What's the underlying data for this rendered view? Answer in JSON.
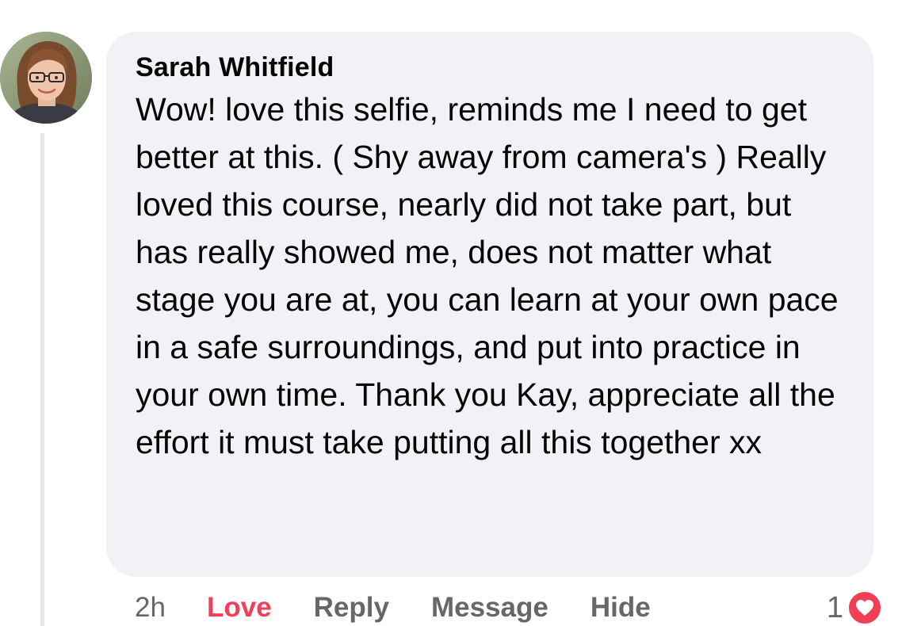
{
  "comment": {
    "author": "Sarah Whitfield",
    "text": "Wow! love this selfie, reminds me I need to get better at this. ( Shy away from camera's ) Really loved this course, nearly did not take part, but has really showed me, does not matter what stage you are at, you can learn at your own pace in a safe surroundings, and put into practice in your own time. Thank you Kay, appreciate all the effort it must take putting all this together xx",
    "avatar_icon": "user-avatar",
    "bubble_color": "#f0f2f5"
  },
  "actions": {
    "time": "2h",
    "love_label": "Love",
    "reply_label": "Reply",
    "message_label": "Message",
    "hide_label": "Hide",
    "love_color": "#f33e58"
  },
  "reaction": {
    "count": "1",
    "icon": "heart-icon",
    "color": "#f33e58"
  }
}
